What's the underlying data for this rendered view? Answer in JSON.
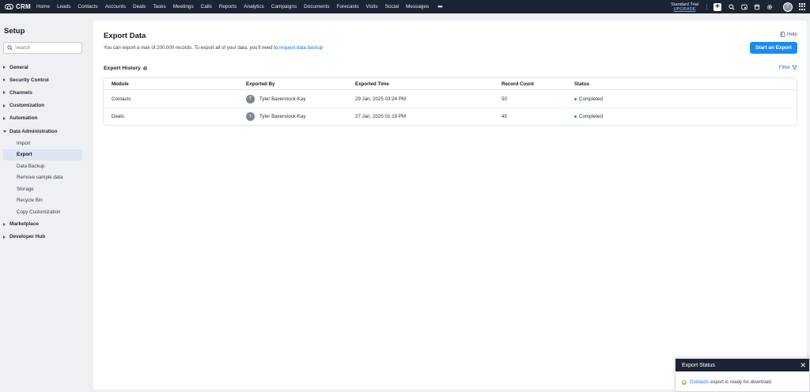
{
  "topbar": {
    "logo_text": "CRM",
    "nav": [
      "Home",
      "Leads",
      "Contacts",
      "Accounts",
      "Deals",
      "Tasks",
      "Meetings",
      "Calls",
      "Reports",
      "Analytics",
      "Campaigns",
      "Documents",
      "Forecasts",
      "Visits",
      "Social",
      "Messages"
    ],
    "more": "•••",
    "trial_label": "Standard Trial",
    "upgrade_label": "UPGRADE",
    "plus": "+",
    "avatar_initial": "T"
  },
  "sidebar": {
    "title": "Setup",
    "search_placeholder": "Search",
    "groups": [
      {
        "label": "General"
      },
      {
        "label": "Security Control"
      },
      {
        "label": "Channels"
      },
      {
        "label": "Customization"
      },
      {
        "label": "Automation"
      },
      {
        "label": "Data Administration"
      }
    ],
    "sub_items": [
      "Import",
      "Export",
      "Data Backup",
      "Remove sample data",
      "Storage",
      "Recycle Bin",
      "Copy Customization"
    ],
    "groups_after": [
      {
        "label": "Marketplace"
      },
      {
        "label": "Developer Hub"
      }
    ]
  },
  "main": {
    "title": "Export Data",
    "help": "Help",
    "desc_prefix": "You can export a max of 200,000 records. To export all of your data, you'll need to ",
    "desc_link": "request data backup",
    "start_button": "Start an Export",
    "history_title": "Export History",
    "info_icon": "i",
    "filter": "Filter",
    "table": {
      "headers": [
        "Module",
        "Exported By",
        "Exported Time",
        "Record Count",
        "Status"
      ],
      "rows": [
        {
          "module": "Contacts",
          "initial": "T",
          "by": "Tyler Baverstock-Kay",
          "time": "29 Jan, 2025 03:24 PM",
          "count": "50",
          "status": "Completed"
        },
        {
          "module": "Deals",
          "initial": "T",
          "by": "Tyler Baverstock-Kay",
          "time": "27 Jan, 2025 01:19 PM",
          "count": "45",
          "status": "Completed"
        }
      ]
    }
  },
  "popup": {
    "title": "Export Status",
    "close": "✕",
    "link": "Contacts",
    "message": "export is ready for download."
  },
  "colors": {
    "nav_bg": "#1c2333",
    "accent": "#1a8cf0",
    "link": "#1a73e8",
    "status_completed": "#22a55a"
  }
}
